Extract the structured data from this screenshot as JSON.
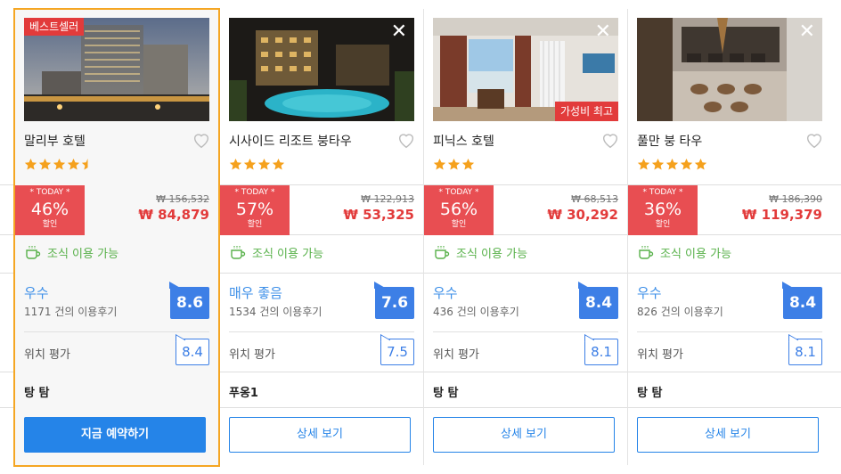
{
  "colors": {
    "accent_blue": "#2584e8",
    "deal_red": "#e84e52",
    "price_red": "#e23b3b",
    "breakfast_green": "#58b14a",
    "star_orange": "#f5a11d",
    "selected_border": "#f5a623"
  },
  "hotels": [
    {
      "badge": "베스트셀러",
      "name": "말리부 호텔",
      "stars": 4.5,
      "today": "* TODAY *",
      "discount": "46%",
      "discount_label": "할인",
      "old_price": "₩ 156,532",
      "new_price": "₩ 84,879",
      "breakfast": "조식 이용 가능",
      "rating_word": "우수",
      "reviews": "1171 건의 이용후기",
      "score": "8.6",
      "location_label": "위치 평가",
      "location_score": "8.4",
      "area": "탕 탐",
      "button": "지금 예약하기",
      "icons": [
        "heart-outline-icon",
        "coffee-cup-icon",
        "star-icon"
      ]
    },
    {
      "name": "시사이드 리조트 붕타우",
      "stars": 4,
      "today": "* TODAY *",
      "discount": "57%",
      "discount_label": "할인",
      "old_price": "₩ 122,913",
      "new_price": "₩ 53,325",
      "breakfast": "조식 이용 가능",
      "rating_word": "매우 좋음",
      "reviews": "1534 건의 이용후기",
      "score": "7.6",
      "location_label": "위치 평가",
      "location_score": "7.5",
      "area": "푸옹1",
      "button": "상세 보기",
      "close": "✕"
    },
    {
      "name": "피닉스 호텔",
      "stars": 3,
      "badge_value": "가성비 최고",
      "today": "* TODAY *",
      "discount": "56%",
      "discount_label": "할인",
      "old_price": "₩ 68,513",
      "new_price": "₩ 30,292",
      "breakfast": "조식 이용 가능",
      "rating_word": "우수",
      "reviews": "436 건의 이용후기",
      "score": "8.4",
      "location_label": "위치 평가",
      "location_score": "8.1",
      "area": "탕 탐",
      "button": "상세 보기",
      "close": "✕"
    },
    {
      "name": "풀만 붕 타우",
      "stars": 5,
      "today": "* TODAY *",
      "discount": "36%",
      "discount_label": "할인",
      "old_price": "₩ 186,390",
      "new_price": "₩ 119,379",
      "breakfast": "조식 이용 가능",
      "rating_word": "우수",
      "reviews": "826 건의 이용후기",
      "score": "8.4",
      "location_label": "위치 평가",
      "location_score": "8.1",
      "area": "탕 탐",
      "button": "상세 보기",
      "close": "✕"
    }
  ]
}
